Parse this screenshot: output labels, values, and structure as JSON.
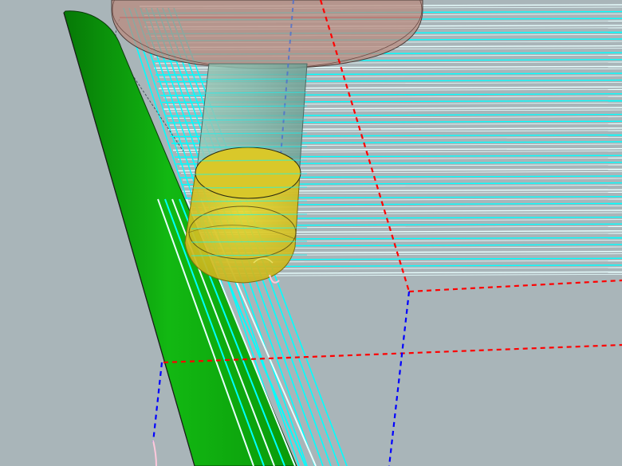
{
  "viewport": {
    "name": "3d-cam-toolpath-view",
    "background": "#a9b5b9",
    "colors": {
      "toolpath_cyan": "#00ffff",
      "toolpath_white": "#e8ffff",
      "wall_surface_green": "#0aa40a",
      "tool_holder": "#b98b7f",
      "tool_shank": "#8fbcae",
      "ball_end_mill": "#d8c622",
      "boundary_red": "#ff0000",
      "boundary_blue": "#0000ff",
      "link_move_pink": "#ffc8dc"
    },
    "icons": {
      "tool": "ball-end-mill-icon",
      "holder": "tool-holder-icon"
    }
  }
}
